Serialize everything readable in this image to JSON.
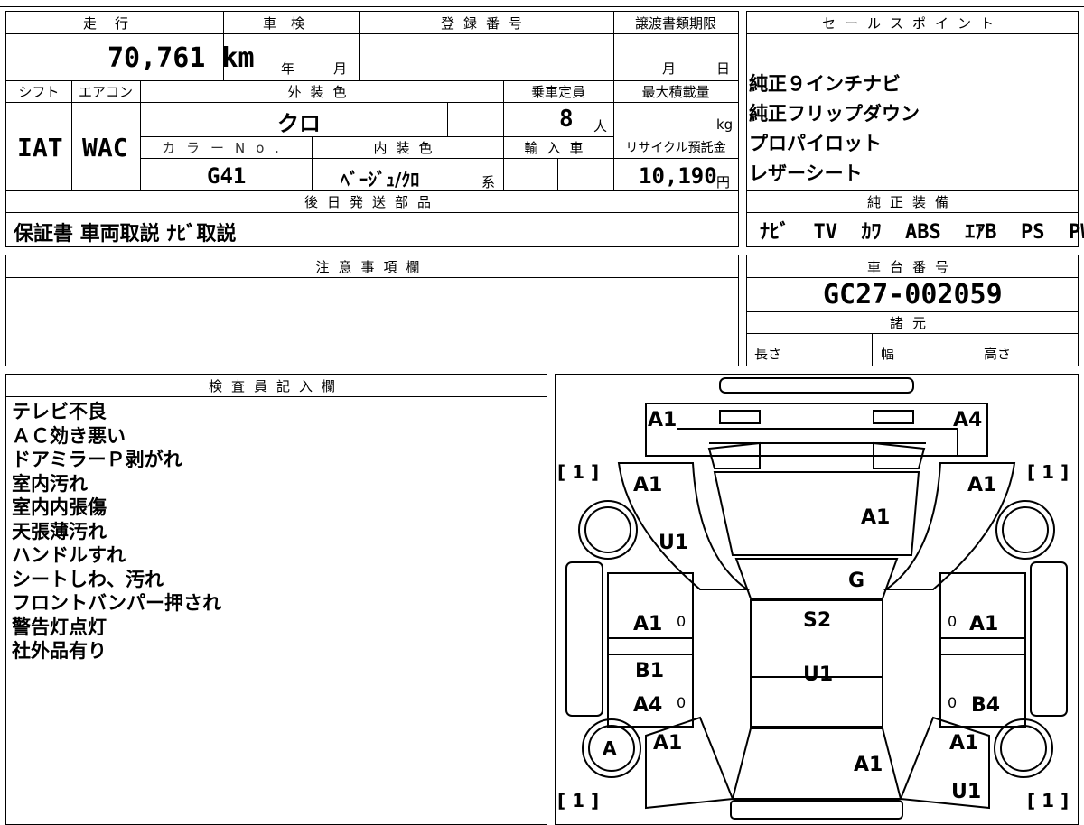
{
  "header": {
    "mileage_label": "走行",
    "inspection_label": "車検",
    "registration_label": "登録番号",
    "transfer_deadline_label": "譲渡書類期限",
    "mileage_value": "70,761 km",
    "inspection_year": "年",
    "inspection_month": "月",
    "deadline_month": "月",
    "deadline_day": "日"
  },
  "specs": {
    "shift_label": "シフト",
    "aircon_label": "エアコン",
    "exterior_color_label": "外装色",
    "capacity_label": "乗車定員",
    "max_load_label": "最大積載量",
    "shift_value": "IAT",
    "aircon_value": "WAC",
    "exterior_color_value": "クロ",
    "capacity_value": "8",
    "capacity_unit": "人",
    "max_load_unit": "kg",
    "color_no_label": "カラーNo.",
    "interior_color_label": "内装色",
    "import_label": "輸入車",
    "recycle_label": "リサイクル預託金",
    "color_no_value": "G41",
    "interior_color_value": "ﾍﾞｰｼﾞｭ/ｸﾛ",
    "interior_suffix": "系",
    "recycle_value": "10,190",
    "recycle_unit": "円"
  },
  "later_parts": {
    "label": "後日発送部品",
    "value": "保証書 車両取説 ﾅﾋﾞ取説"
  },
  "sales_points": {
    "label": "セールスポイント",
    "items": [
      "純正９インチナビ",
      "純正フリップダウン",
      "プロパイロット",
      "レザーシート"
    ]
  },
  "equipment": {
    "label": "純正装備",
    "items": [
      "ﾅﾋﾞ",
      "TV",
      "ｶﾜ",
      "ABS",
      "ｴｱB",
      "PS",
      "PW"
    ]
  },
  "caution": {
    "label": "注意事項欄"
  },
  "chassis": {
    "label": "車台番号",
    "value": "GC27-002059"
  },
  "dimensions": {
    "label": "諸元",
    "length_label": "長さ",
    "width_label": "幅",
    "height_label": "高さ"
  },
  "inspector": {
    "label": "検査員記入欄",
    "notes": [
      "テレビ不良",
      "ＡＣ効き悪い",
      "ドアミラーＰ剥がれ",
      "室内汚れ",
      "室内内張傷",
      "天張薄汚れ",
      "ハンドルすれ",
      "シートしわ、汚れ",
      "フロントバンパー押され",
      "警告灯点灯",
      "社外品有り"
    ]
  },
  "diagram": {
    "codes": {
      "front_left": "A1",
      "front_right": "A4",
      "hood": "A1",
      "fender_left": "A1",
      "fender_right": "A1",
      "fender_left_lower": "U1",
      "windshield": "G",
      "roof": "S2",
      "roof_rear": "U1",
      "door_fl": "A1",
      "door_fr": "A1",
      "door_rl_upper": "B1",
      "door_rl_lower": "A4",
      "door_rr": "B4",
      "quarter_left": "A1",
      "quarter_right": "A1",
      "quarter_right_lower": "U1",
      "rear_hatch": "A1",
      "tire_rear_left": "A"
    },
    "tire_counts": {
      "front_left": "[ 1 ]",
      "front_right": "[ 1 ]",
      "rear_left": "[ 1 ]",
      "rear_right": "[ 1 ]"
    },
    "zero_marks": {
      "fl": "0",
      "fr": "0",
      "rl": "0",
      "rr": "0"
    }
  }
}
